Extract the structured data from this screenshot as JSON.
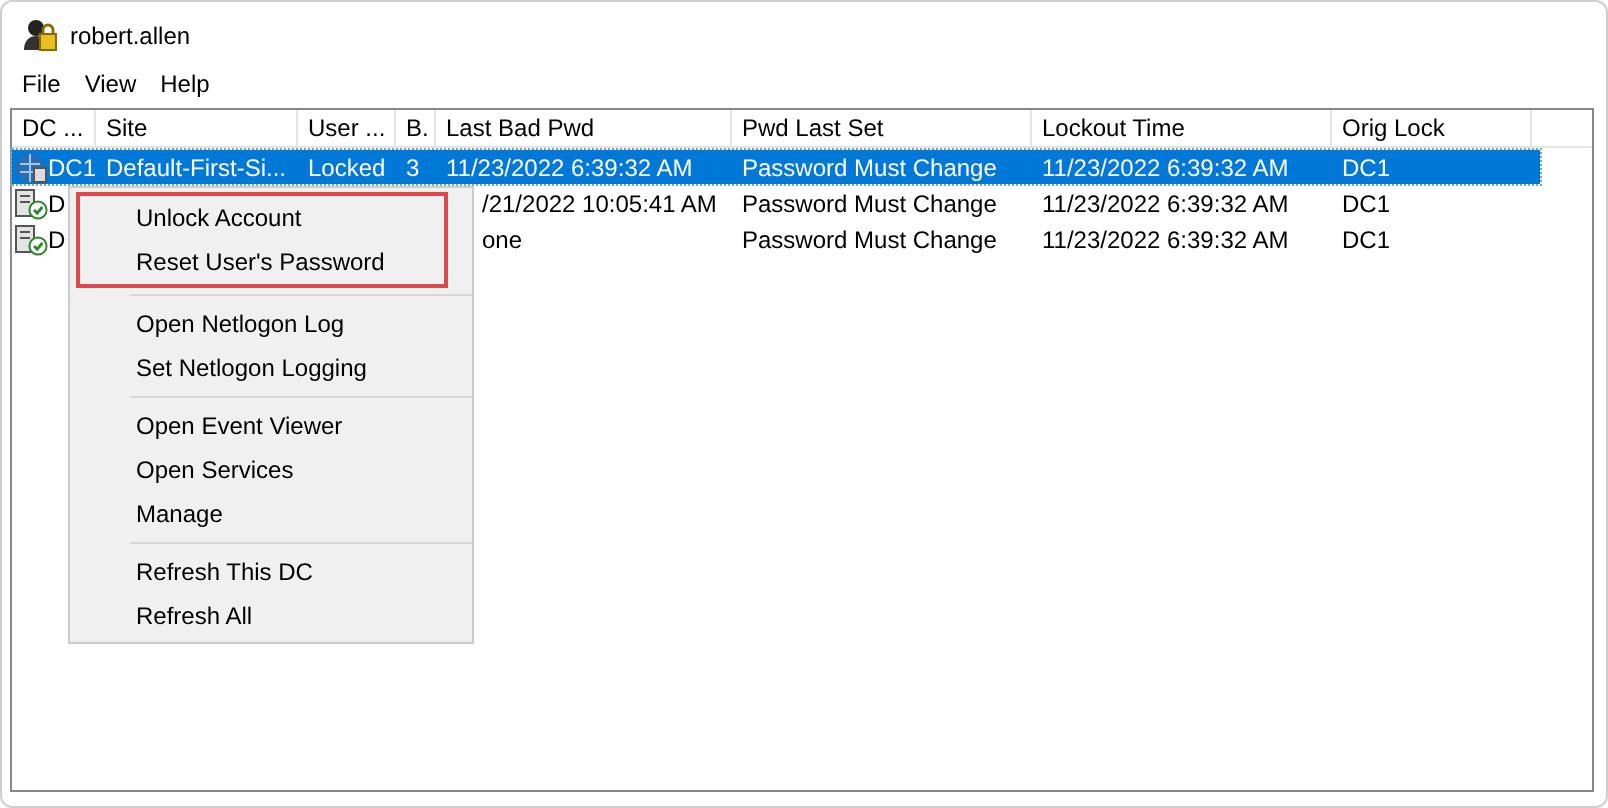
{
  "window": {
    "title": "robert.allen"
  },
  "menu_bar": [
    "File",
    "View",
    "Help"
  ],
  "table": {
    "columns": [
      "DC ...",
      "Site",
      "User ...",
      "B.",
      "Last Bad Pwd",
      "Pwd Last Set",
      "Lockout Time",
      "Orig Lock"
    ],
    "rows": [
      {
        "selected": true,
        "kind": "locked",
        "cells": {
          "0": "DC1",
          "1": "Default-First-Si...",
          "2": "Locked",
          "3": "3",
          "4": "11/23/2022 6:39:32 AM",
          "5": "Password Must Change",
          "6": "11/23/2022 6:39:32 AM",
          "7": "DC1"
        }
      },
      {
        "selected": false,
        "kind": "ok",
        "cells": {
          "0": "D",
          "4": "/21/2022 10:05:41 AM",
          "5": "Password Must Change",
          "6": "11/23/2022 6:39:32 AM",
          "7": "DC1"
        }
      },
      {
        "selected": false,
        "kind": "ok",
        "cells": {
          "0": "D",
          "4": "one",
          "5": "Password Must Change",
          "6": "11/23/2022 6:39:32 AM",
          "7": "DC1"
        }
      }
    ]
  },
  "context_menu": {
    "groups": [
      {
        "highlighted": true,
        "items": [
          "Unlock Account",
          "Reset User's Password"
        ]
      },
      {
        "highlighted": false,
        "items": [
          "Open Netlogon Log",
          "Set Netlogon Logging"
        ]
      },
      {
        "highlighted": false,
        "items": [
          "Open Event Viewer",
          "Open Services",
          "Manage"
        ]
      },
      {
        "highlighted": false,
        "items": [
          "Refresh This DC",
          "Refresh All"
        ]
      }
    ]
  }
}
